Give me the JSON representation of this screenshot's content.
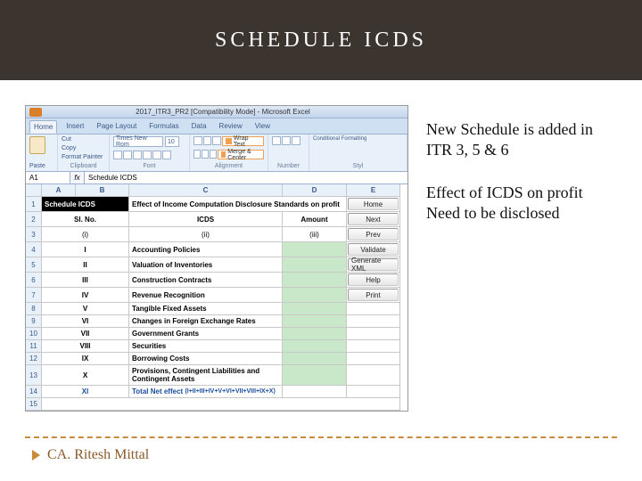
{
  "slide": {
    "title": "SCHEDULE ICDS",
    "author": "CA. Ritesh Mittal",
    "note1": "New Schedule is added in  ITR 3, 5 & 6",
    "note2": "Effect of ICDS on profit Need to be disclosed"
  },
  "excel": {
    "window_title": "2017_ITR3_PR2 [Compatibility Mode] - Microsoft Excel",
    "tabs": [
      "Home",
      "Insert",
      "Page Layout",
      "Formulas",
      "Data",
      "Review",
      "View"
    ],
    "clipboard": {
      "cut": "Cut",
      "copy": "Copy",
      "format_painter": "Format Painter",
      "paste": "Paste",
      "group_label": "Clipboard"
    },
    "font": {
      "name": "Times New Rom",
      "size": "10",
      "group_label": "Font"
    },
    "alignment": {
      "wrap": "Wrap Text",
      "merge": "Merge & Center",
      "group_label": "Alignment"
    },
    "number": {
      "group_label": "Number"
    },
    "styles": {
      "cond": "Conditional Formatting",
      "group_label": "Styl"
    },
    "formula_bar": {
      "cell": "A1",
      "fx": "fx",
      "value": "Schedule ICDS"
    },
    "columns": [
      "",
      "A",
      "B",
      "C",
      "D",
      "E"
    ],
    "header_row": {
      "schedule": "Schedule ICDS",
      "desc": "Effect of Income Computation Disclosure Standards on profit"
    },
    "col_headers": {
      "sl": "Sl. No.",
      "icds": "ICDS",
      "amount": "Amount"
    },
    "sub_headers": {
      "i": "(i)",
      "ii": "(ii)",
      "iii": "(iii)"
    },
    "rows": [
      {
        "n": "I",
        "text": "Accounting Policies"
      },
      {
        "n": "II",
        "text": "Valuation of Inventories"
      },
      {
        "n": "III",
        "text": "Construction Contracts"
      },
      {
        "n": "IV",
        "text": "Revenue Recognition"
      },
      {
        "n": "V",
        "text": "Tangible Fixed Assets"
      },
      {
        "n": "VI",
        "text": "Changes in Foreign Exchange Rates"
      },
      {
        "n": "VII",
        "text": "Government Grants"
      },
      {
        "n": "VIII",
        "text": "Securities"
      },
      {
        "n": "IX",
        "text": "Borrowing Costs"
      },
      {
        "n": "X",
        "text": "Provisions, Contingent Liabilities and Contingent Assets"
      }
    ],
    "total": {
      "n": "XI",
      "label": "Total Net effect",
      "formula": "(I+II+III+IV+V+VI+VII+VIII+IX+X)"
    },
    "buttons": [
      "Home",
      "Next",
      "Prev",
      "Validate",
      "Generate XML",
      "Help",
      "Print"
    ]
  }
}
